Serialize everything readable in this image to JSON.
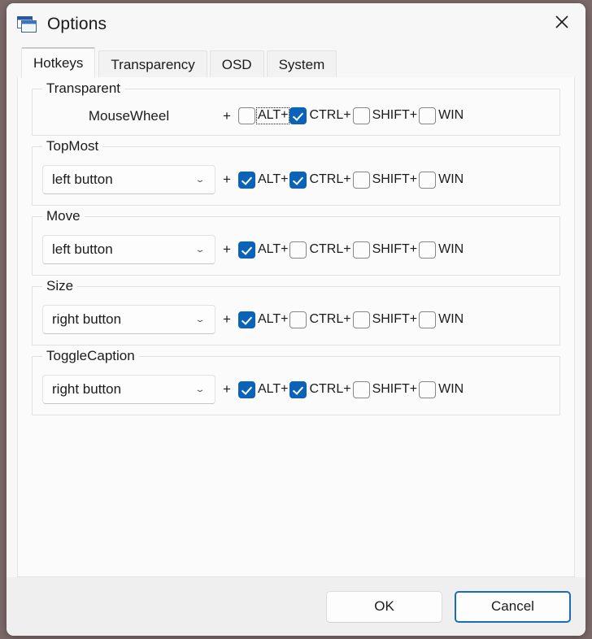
{
  "window": {
    "title": "Options",
    "icon": "windows-stack-icon",
    "close_label": "✕",
    "accent_color": "#0a63b8",
    "background_color": "#f7f7f7"
  },
  "tabs": [
    {
      "label": "Hotkeys",
      "selected": true
    },
    {
      "label": "Transparency",
      "selected": false
    },
    {
      "label": "OSD",
      "selected": false
    },
    {
      "label": "System",
      "selected": false
    }
  ],
  "groups": [
    {
      "title": "Transparent",
      "trigger_type": "static",
      "trigger_value": "MouseWheel",
      "plus": "+",
      "modifiers": [
        {
          "label": "ALT+",
          "checked": false,
          "focused": true
        },
        {
          "label": "CTRL+",
          "checked": true,
          "focused": false
        },
        {
          "label": "SHIFT+",
          "checked": false,
          "focused": false
        },
        {
          "label": "WIN",
          "checked": false,
          "focused": false
        }
      ]
    },
    {
      "title": "TopMost",
      "trigger_type": "combo",
      "trigger_value": "left button",
      "chevron": "⌄",
      "plus": "+",
      "modifiers": [
        {
          "label": "ALT+",
          "checked": true,
          "focused": false
        },
        {
          "label": "CTRL+",
          "checked": true,
          "focused": false
        },
        {
          "label": "SHIFT+",
          "checked": false,
          "focused": false
        },
        {
          "label": "WIN",
          "checked": false,
          "focused": false
        }
      ]
    },
    {
      "title": "Move",
      "trigger_type": "combo",
      "trigger_value": "left button",
      "chevron": "⌄",
      "plus": "+",
      "modifiers": [
        {
          "label": "ALT+",
          "checked": true,
          "focused": false
        },
        {
          "label": "CTRL+",
          "checked": false,
          "focused": false
        },
        {
          "label": "SHIFT+",
          "checked": false,
          "focused": false
        },
        {
          "label": "WIN",
          "checked": false,
          "focused": false
        }
      ]
    },
    {
      "title": "Size",
      "trigger_type": "combo",
      "trigger_value": "right button",
      "chevron": "⌄",
      "plus": "+",
      "modifiers": [
        {
          "label": "ALT+",
          "checked": true,
          "focused": false
        },
        {
          "label": "CTRL+",
          "checked": false,
          "focused": false
        },
        {
          "label": "SHIFT+",
          "checked": false,
          "focused": false
        },
        {
          "label": "WIN",
          "checked": false,
          "focused": false
        }
      ]
    },
    {
      "title": "ToggleCaption",
      "trigger_type": "combo",
      "trigger_value": "right button",
      "chevron": "⌄",
      "plus": "+",
      "modifiers": [
        {
          "label": "ALT+",
          "checked": true,
          "focused": false
        },
        {
          "label": "CTRL+",
          "checked": true,
          "focused": false
        },
        {
          "label": "SHIFT+",
          "checked": false,
          "focused": false
        },
        {
          "label": "WIN",
          "checked": false,
          "focused": false
        }
      ]
    }
  ],
  "footer": {
    "ok_label": "OK",
    "cancel_label": "Cancel"
  }
}
